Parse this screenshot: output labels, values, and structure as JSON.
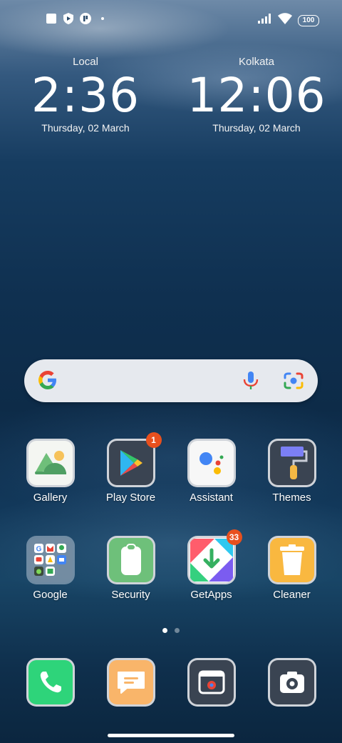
{
  "status_bar": {
    "battery": "100",
    "left_icons": [
      "square-icon",
      "shield-icon",
      "app-notification-icon",
      "dot-icon"
    ],
    "right_icons": [
      "signal-icon",
      "wifi-icon",
      "battery-icon"
    ]
  },
  "clocks": [
    {
      "city": "Local",
      "time": "2:36",
      "date": "Thursday, 02 March"
    },
    {
      "city": "Kolkata",
      "time": "12:06",
      "date": "Thursday, 02 March"
    }
  ],
  "search": {
    "icons": [
      "google-g-icon",
      "mic-icon",
      "lens-icon"
    ]
  },
  "apps": [
    {
      "label": "Gallery",
      "icon": "gallery-icon"
    },
    {
      "label": "Play Store",
      "icon": "play-store-icon",
      "badge": "1"
    },
    {
      "label": "Assistant",
      "icon": "assistant-icon"
    },
    {
      "label": "Themes",
      "icon": "themes-icon"
    },
    {
      "label": "Google",
      "icon": "google-folder-icon"
    },
    {
      "label": "Security",
      "icon": "security-icon"
    },
    {
      "label": "GetApps",
      "icon": "getapps-icon",
      "badge": "33"
    },
    {
      "label": "Cleaner",
      "icon": "cleaner-icon"
    }
  ],
  "dock": [
    {
      "icon": "phone-icon"
    },
    {
      "icon": "messages-icon"
    },
    {
      "icon": "browser-icon"
    },
    {
      "icon": "camera-icon"
    }
  ],
  "page_indicator": {
    "pages": 2,
    "current": 1
  },
  "colors": {
    "badge": "#e8501e",
    "accent_green": "#2ecc71"
  }
}
